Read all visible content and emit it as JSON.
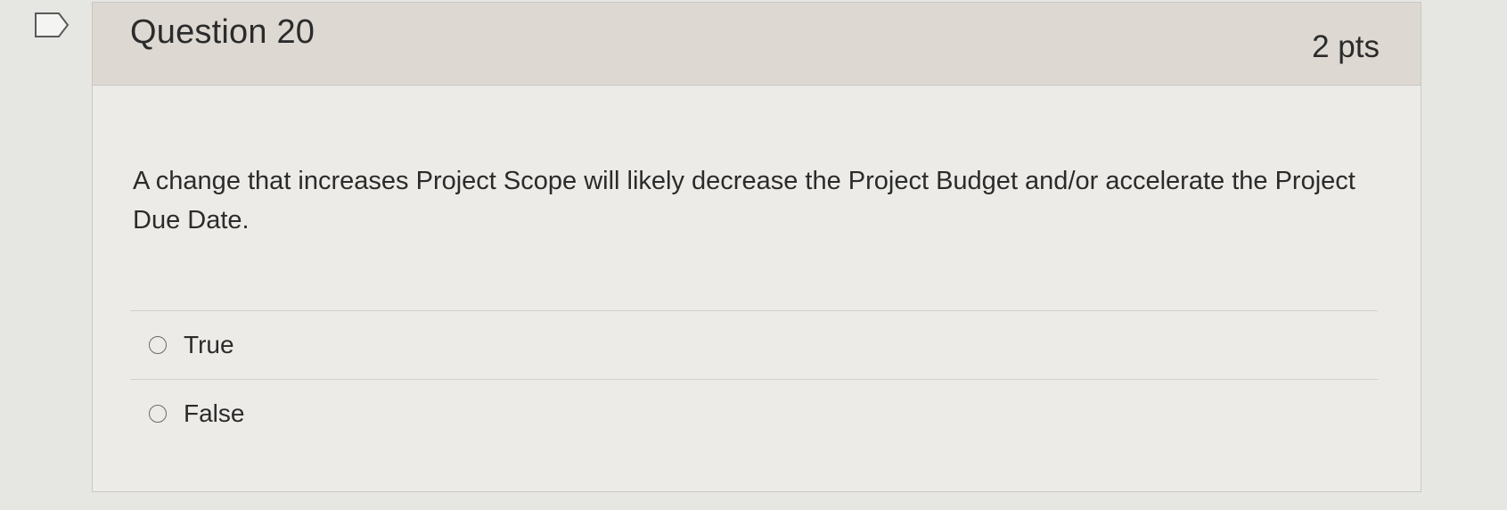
{
  "question": {
    "title": "Question 20",
    "points": "2 pts",
    "text": "A change that increases Project Scope will likely decrease the Project Budget and/or accelerate the Project Due Date.",
    "answers": [
      {
        "label": "True",
        "selected": false
      },
      {
        "label": "False",
        "selected": false
      }
    ],
    "flag_icon": "flag-bookmark-icon"
  }
}
